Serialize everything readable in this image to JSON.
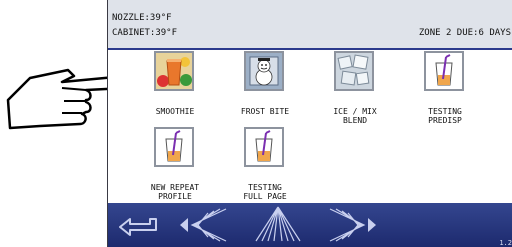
{
  "status": {
    "nozzle": "NOZZLE:39°F",
    "cabinet": "CABINET:39°F",
    "zone_due": "ZONE 2 DUE:6 DAYS"
  },
  "menu_items": [
    {
      "label": "SMOOTHIE",
      "icon": "smoothie-icon"
    },
    {
      "label": "FROST BITE",
      "icon": "frost-bite-icon"
    },
    {
      "label": "ICE / MIX\nBLEND",
      "icon": "ice-mix-blend-icon"
    },
    {
      "label": "TESTING\nPREDISP",
      "icon": "cup-straw-icon"
    },
    {
      "label": "NEW REPEAT\nPROFILE",
      "icon": "cup-straw-icon"
    },
    {
      "label": "TESTING\nFULL PAGE",
      "icon": "cup-straw-icon"
    }
  ],
  "footer": {
    "back": "back-arrow-icon",
    "left": "scroll-left-icon",
    "up": "scroll-up-icon",
    "right": "scroll-right-icon",
    "version": "1.2"
  },
  "colors": {
    "header_bg": "#dfe3ea",
    "header_border": "#2b3a8c",
    "footer_bg": "#1d2a6e",
    "arrow": "#c9d0ef"
  }
}
